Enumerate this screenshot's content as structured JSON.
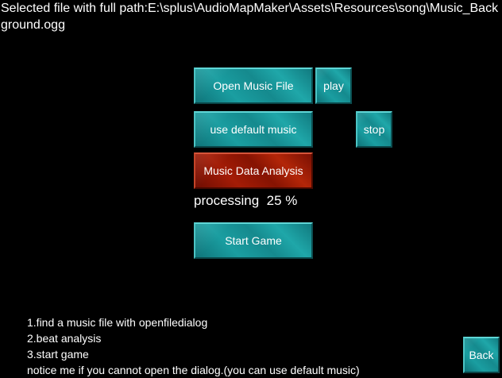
{
  "file_info": {
    "path_text": "Selected file with full path:E:\\splus\\AudioMapMaker\\Assets\\Resources\\song\\Music_Background.ogg"
  },
  "buttons": {
    "open_music_file": "Open Music File",
    "play": "play",
    "use_default_music": "use default music",
    "stop": "stop",
    "music_data_analysis": "Music Data Analysis",
    "start_game": "Start Game",
    "back": "Back"
  },
  "progress": {
    "label": "processing",
    "value": 25,
    "display": "processing  25 %"
  },
  "instructions": [
    "1.find a music file with openfiledialog",
    "2.beat analysis",
    "3.start game",
    "notice me if you cannot open the dialog.(you can use default music)"
  ],
  "colors": {
    "background": "#000000",
    "button_teal": "#1a9ea1",
    "button_red_active": "#a41c06",
    "text": "#ffffff"
  }
}
